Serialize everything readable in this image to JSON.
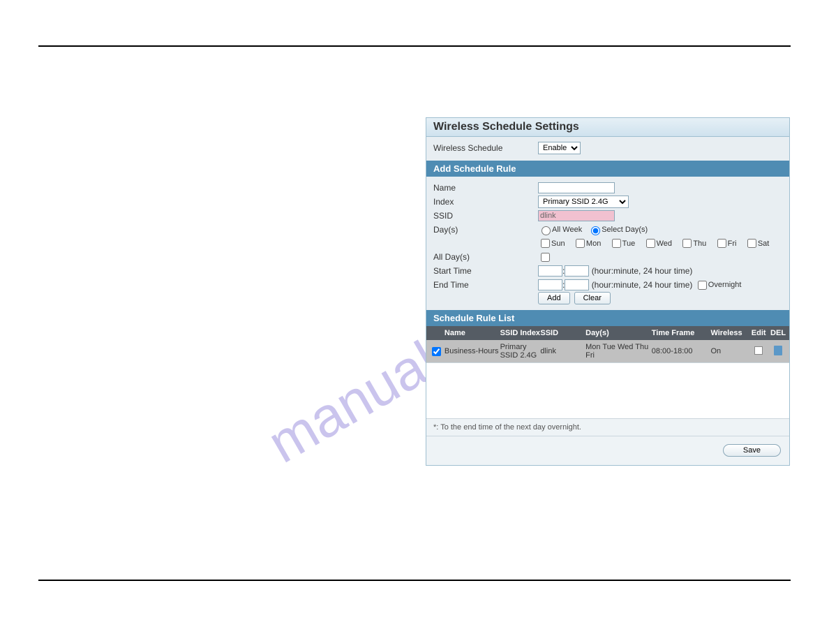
{
  "watermark": "manualshive.com",
  "title": "Wireless Schedule Settings",
  "schedule": {
    "label": "Wireless Schedule",
    "value": "Enable"
  },
  "addRule": {
    "heading": "Add Schedule Rule",
    "name_label": "Name",
    "name_value": "",
    "index_label": "Index",
    "index_value": "Primary SSID 2.4G",
    "ssid_label": "SSID",
    "ssid_value": "dlink",
    "days_label": "Day(s)",
    "allweek_label": "All Week",
    "selectdays_label": "Select Day(s)",
    "days": [
      "Sun",
      "Mon",
      "Tue",
      "Wed",
      "Thu",
      "Fri",
      "Sat"
    ],
    "alldays_label": "All Day(s)",
    "start_label": "Start Time",
    "end_label": "End Time",
    "time_hint": "(hour:minute, 24 hour time)",
    "overnight_label": "Overnight",
    "add_btn": "Add",
    "clear_btn": "Clear"
  },
  "list": {
    "heading": "Schedule Rule List",
    "headers": {
      "name": "Name",
      "ssid_index": "SSID Index",
      "ssid": "SSID",
      "days": "Day(s)",
      "timeframe": "Time Frame",
      "wireless": "Wireless",
      "edit": "Edit",
      "del": "DEL"
    },
    "rows": [
      {
        "checked": true,
        "name": "Business-Hours",
        "ssid_index": "Primary SSID 2.4G",
        "ssid": "dlink",
        "days": "Mon Tue Wed Thu Fri",
        "timeframe": "08:00-18:00",
        "wireless": "On"
      }
    ],
    "footnote": "*: To the end time of the next day overnight."
  },
  "save_btn": "Save"
}
